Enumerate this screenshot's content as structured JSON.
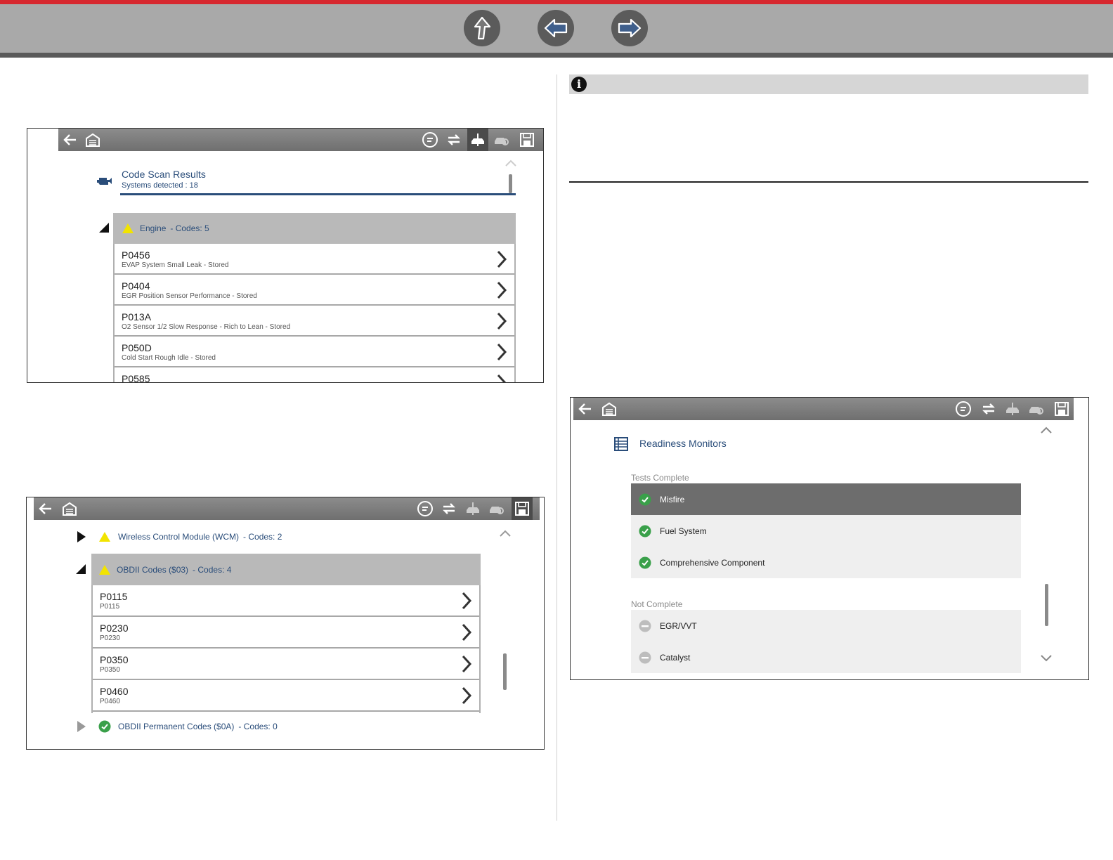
{
  "nav": {
    "buttons": [
      "up-arrow-icon",
      "back-arrow-icon",
      "forward-arrow-icon"
    ]
  },
  "screen1": {
    "title": "Code Scan Results",
    "subtitle": "Systems detected : 18",
    "group": {
      "name": "Engine",
      "count": "- Codes: 5"
    },
    "codes": [
      {
        "code": "P0456",
        "desc": "EVAP System Small Leak - Stored"
      },
      {
        "code": "P0404",
        "desc": "EGR Position Sensor Performance - Stored"
      },
      {
        "code": "P013A",
        "desc": "O2 Sensor 1/2 Slow Response - Rich to Lean - Stored"
      },
      {
        "code": "P050D",
        "desc": "Cold Start Rough Idle - Stored"
      },
      {
        "code": "P0585",
        "desc": ""
      }
    ]
  },
  "screen2": {
    "groups": [
      {
        "name": "Wireless Control Module (WCM)",
        "count": "- Codes: 2"
      },
      {
        "name": "OBDII Codes ($03)",
        "count": "- Codes: 4"
      },
      {
        "name": "OBDII Permanent Codes ($0A)",
        "count": "- Codes: 0"
      }
    ],
    "codes": [
      {
        "code": "P0115",
        "desc": "P0115"
      },
      {
        "code": "P0230",
        "desc": "P0230"
      },
      {
        "code": "P0350",
        "desc": "P0350"
      },
      {
        "code": "P0460",
        "desc": "P0460"
      }
    ]
  },
  "screen3": {
    "title": "Readiness Monitors",
    "complete_label": "Tests Complete",
    "not_complete_label": "Not Complete",
    "complete": [
      "Misfire",
      "Fuel System",
      "Comprehensive Component"
    ],
    "not_complete": [
      "EGR/VVT",
      "Catalyst"
    ]
  },
  "colors": {
    "accent": "#d7282f",
    "title_blue": "#2a4d7a",
    "warning": "#f2e400",
    "ok_green": "#3aa04a"
  }
}
